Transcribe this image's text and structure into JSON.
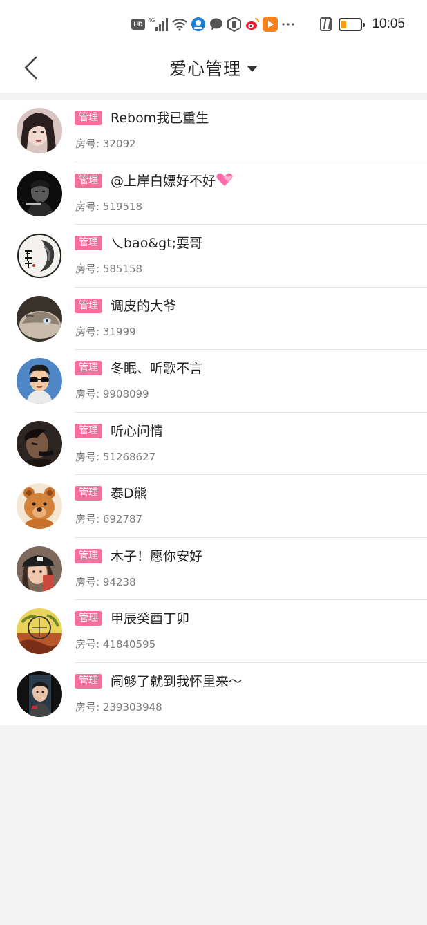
{
  "status_bar": {
    "hd_label": "HD",
    "network_label": "4G",
    "time": "10:05",
    "battery_level": 0.25,
    "icons": [
      "hd-icon",
      "signal-icon",
      "wifi-icon",
      "app-notification-icon",
      "message-icon",
      "vpn-icon",
      "weibo-icon",
      "video-app-icon",
      "more-icon",
      "nfc-icon",
      "battery-icon"
    ]
  },
  "header": {
    "title": "爱心管理",
    "back_icon": "chevron-left-icon",
    "dropdown_icon": "caret-down-icon"
  },
  "colors": {
    "badge": "#f2719b",
    "divider": "#e4e4e4",
    "background": "#f4f4f4",
    "battery": "#f39c12"
  },
  "items": [
    {
      "badge": "管理",
      "name": "Rebom我已重生",
      "room": "房号: 32092"
    },
    {
      "badge": "管理",
      "name": "@上岸白嫖好不好",
      "room": "房号: 519518",
      "emoji": "heart-icon"
    },
    {
      "badge": "管理",
      "name": "乀bao&gt;耍哥",
      "room": "房号: 585158"
    },
    {
      "badge": "管理",
      "name": "调皮的大爷",
      "room": "房号: 31999"
    },
    {
      "badge": "管理",
      "name": "冬眠、听歌不言",
      "room": "房号: 9908099"
    },
    {
      "badge": "管理",
      "name": "听心问情",
      "room": "房号: 51268627"
    },
    {
      "badge": "管理",
      "name": "泰D熊",
      "room": "房号: 692787"
    },
    {
      "badge": "管理",
      "name": "木子！愿你安好",
      "room": "房号: 94238"
    },
    {
      "badge": "管理",
      "name": "甲辰癸酉丁卯",
      "room": "房号: 41840595"
    },
    {
      "badge": "管理",
      "name": "闹够了就到我怀里来～",
      "room": "房号: 239303948"
    }
  ]
}
